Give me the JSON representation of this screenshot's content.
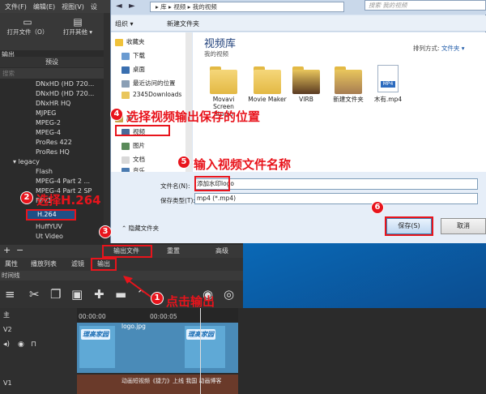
{
  "app": {
    "menu": [
      "文件(F)",
      "编辑(E)",
      "视图(V)",
      "设"
    ],
    "open_file_label": "打开文件（O）",
    "open_other_label": "打开其他 ▾",
    "output_label": "输出",
    "presets_header": "预设",
    "search_placeholder": "搜索",
    "presets": [
      "DNxHD (HD 720...",
      "DNxHD (HD 720...",
      "DNxHR HQ",
      "MJPEG",
      "MPEG-2",
      "MPEG-4",
      "ProRes 422",
      "ProRes HQ",
      "legacy",
      "Flash",
      "MPEG-4 Part 2 ...",
      "MPEG-4 Part 2 SP",
      "FFV1",
      "H.264",
      "HuffYUV",
      "Ut Video"
    ],
    "selected_preset": "H.264",
    "export_file_label": "输出文件",
    "reset_label": "重置",
    "advanced_label": "高级",
    "tabs": [
      "属性",
      "播放列表",
      "滤镜",
      "输出"
    ],
    "right_tabs": [
      "源",
      "项目"
    ],
    "timeline_label": "时间线",
    "ruler": [
      "00:00:00",
      "00:00:05"
    ],
    "tracks": [
      "主",
      "V2",
      "V1"
    ],
    "clip_v2_name": "logo.jpg",
    "clip_v1_name": "动画短视频《捷力》上线 我国 动画博客",
    "logo_text": "理高家园"
  },
  "dialog": {
    "address": [
      "库",
      "视频",
      "我的视频"
    ],
    "search_placeholder": "搜索 我的视频",
    "organize_label": "组织 ▾",
    "new_folder_label": "新建文件夹",
    "nav_items": [
      "收藏夹",
      "下载",
      "桌面",
      "最近访问的位置",
      "2345Downloads",
      "库",
      "视频",
      "图片",
      "文档",
      "音乐"
    ],
    "library_title": "视频库",
    "library_subtitle": "我的视频",
    "arrange_label": "排列方式:",
    "arrange_value": "文件夹 ▾",
    "items": [
      {
        "name": "Movavi Screen Studio",
        "type": "folder"
      },
      {
        "name": "Movie Maker",
        "type": "folder"
      },
      {
        "name": "VIRB",
        "type": "folder"
      },
      {
        "name": "新建文件夹",
        "type": "folder"
      },
      {
        "name": "木有.mp4",
        "type": "mp4"
      }
    ],
    "mp4_badge": "MP4",
    "filename_label": "文件名(N):",
    "filename_value": "添加水印logo",
    "filetype_label": "保存类型(T):",
    "filetype_value": "mp4 (*.mp4)",
    "hide_folders_label": "隐藏文件夹",
    "save_label": "保存(S)",
    "cancel_label": "取消"
  },
  "annotations": [
    {
      "num": "1",
      "text": "点击输出"
    },
    {
      "num": "2",
      "text": "选择H.264"
    },
    {
      "num": "3",
      "text": ""
    },
    {
      "num": "4",
      "text": "选择视频输出保存的位置"
    },
    {
      "num": "5",
      "text": "输入视频文件名称"
    },
    {
      "num": "6",
      "text": ""
    }
  ],
  "colors": {
    "annotation_red": "#e8141c",
    "selection_blue": "#1f4f86",
    "clip_blue": "#4a8bb8"
  }
}
